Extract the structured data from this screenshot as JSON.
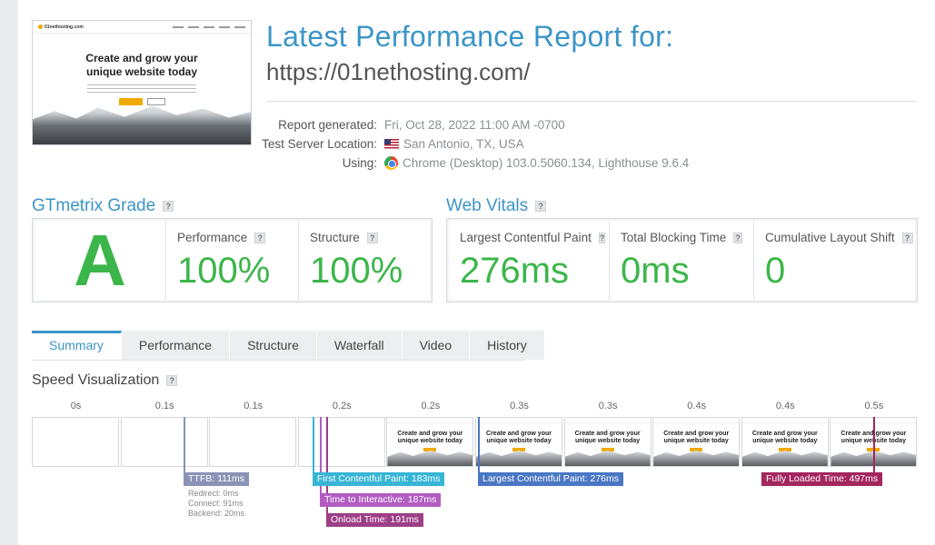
{
  "report": {
    "title": "Latest Performance Report for:",
    "url": "https://01nethosting.com/",
    "meta": [
      {
        "label": "Report generated:",
        "value": "Fri, Oct 28, 2022 11:00 AM -0700",
        "icon": ""
      },
      {
        "label": "Test Server Location:",
        "value": "San Antonio, TX, USA",
        "icon": "us-flag-icon"
      },
      {
        "label": "Using:",
        "value": "Chrome (Desktop) 103.0.5060.134, Lighthouse 9.6.4",
        "icon": "chrome-icon"
      }
    ]
  },
  "thumbnail": {
    "logo": "01nethosting.com",
    "headline_1": "Create and grow your",
    "headline_2": "unique website today"
  },
  "grade": {
    "section_title": "GTmetrix Grade",
    "letter": "A",
    "performance_label": "Performance",
    "performance_value": "100%",
    "structure_label": "Structure",
    "structure_value": "100%"
  },
  "vitals": {
    "section_title": "Web Vitals",
    "lcp_label": "Largest Contentful Paint",
    "lcp_value": "276ms",
    "tbt_label": "Total Blocking Time",
    "tbt_value": "0ms",
    "cls_label": "Cumulative Layout Shift",
    "cls_value": "0"
  },
  "help_glyph": "?",
  "tabs": [
    "Summary",
    "Performance",
    "Structure",
    "Waterfall",
    "Video",
    "History"
  ],
  "active_tab": "Summary",
  "speed": {
    "section_title": "Speed Visualization",
    "time_labels": [
      "0s",
      "0.1s",
      "0.1s",
      "0.2s",
      "0.2s",
      "0.3s",
      "0.3s",
      "0.4s",
      "0.4s",
      "0.5s"
    ],
    "markers": {
      "ttfb": "TTFB: 111ms",
      "redirect": "Redirect: 0ms",
      "connect": "Connect: 91ms",
      "backend": "Backend: 20ms",
      "fcp": "First Contentful Paint: 183ms",
      "tti": "Time to Interactive: 187ms",
      "onload": "Onload Time: 191ms",
      "lcp": "Largest Contentful Paint: 276ms",
      "fully_loaded": "Fully Loaded Time: 497ms"
    },
    "frame_headline_1": "Create and grow your",
    "frame_headline_2": "unique website today"
  },
  "colors": {
    "accent": "#3b95c7",
    "good": "#3cb64a",
    "ttfb": "#8a93b5",
    "fcp": "#37b5d6",
    "tti": "#b25cc2",
    "onload": "#9c3f86",
    "lcp": "#4a77c4",
    "fully": "#a3265f"
  }
}
